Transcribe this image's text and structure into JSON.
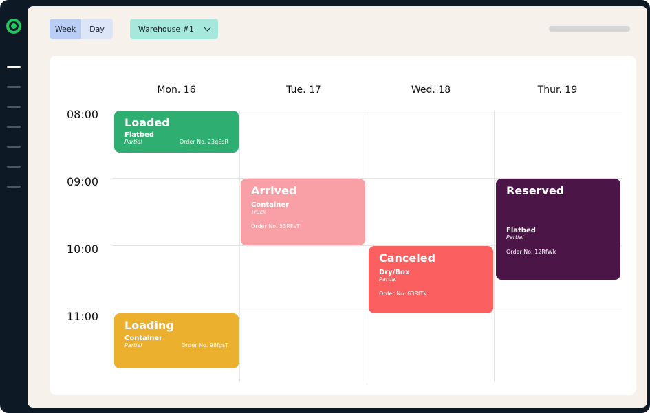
{
  "toolbar": {
    "view_week": "Week",
    "view_day": "Day",
    "warehouse": "Warehouse #1"
  },
  "calendar": {
    "days": [
      "Mon. 16",
      "Tue. 17",
      "Wed. 18",
      "Thur. 19"
    ],
    "times": [
      "08:00",
      "09:00",
      "10:00",
      "11:00"
    ],
    "events": [
      {
        "status": "Loaded",
        "type": "Flatbed",
        "load": "Partial",
        "order": "Order No. 23qEsR",
        "color": "#2fae72"
      },
      {
        "status": "Arrived",
        "type": "Container",
        "load": "Truck",
        "order": "Order No. 53RFsT",
        "color": "#f9a0a6"
      },
      {
        "status": "Canceled",
        "type": "Dry/Box",
        "load": "Partial",
        "order": "Order No. 63RfTk",
        "color": "#fc5f5f"
      },
      {
        "status": "Reserved",
        "type": "Flatbed",
        "load": "Partial",
        "order": "Order No. 12RfWk",
        "color": "#4c1548"
      },
      {
        "status": "Loading",
        "type": "Container",
        "load": "Partial",
        "order": "Order No. 98fgsT",
        "color": "#ebb02e"
      }
    ]
  },
  "icons": {
    "logo": "logo-ring-icon",
    "menu": "menu-line-icon",
    "dropdown": "chevron-down-icon"
  }
}
